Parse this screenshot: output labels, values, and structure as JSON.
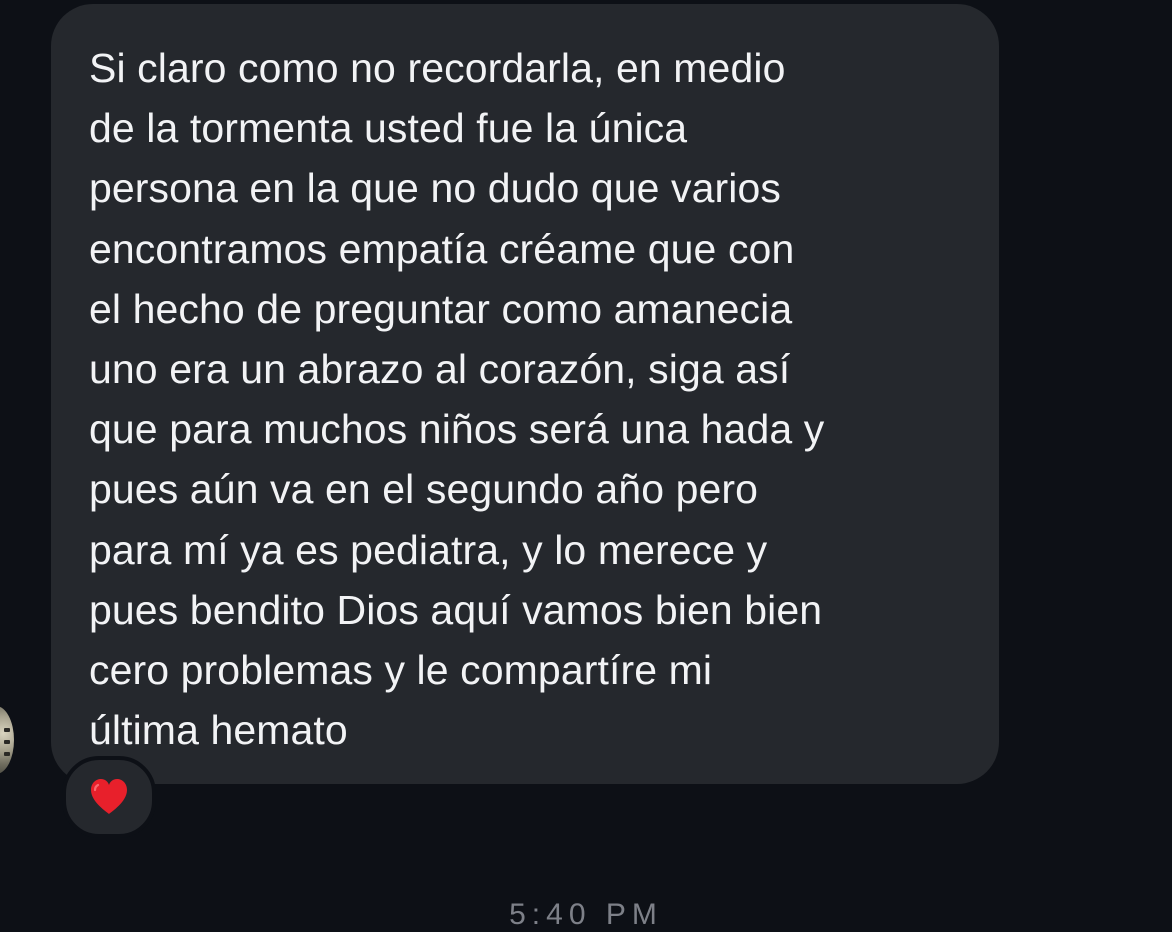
{
  "message": {
    "lines": [
      "Si claro como no recordarla, en medio",
      "de la tormenta usted fue la única",
      "persona en la que no dudo que varios",
      "encontramos empatía créame que con",
      "el hecho de preguntar como amanecia",
      "uno era un abrazo al corazón, siga así",
      "que para muchos niños será una hada y",
      "pues aún va en el segundo año pero",
      "para mí ya es pediatra, y lo merece y",
      "pues bendito Dios aquí vamos bien bien",
      "cero problemas y le compartíre mi",
      "última hemato"
    ],
    "bubble_color": "#25282d",
    "text_color": "#f2f3f5"
  },
  "reaction": {
    "icon": "red-heart-icon",
    "color": "#e8202b"
  },
  "timestamp": "5:40 PM",
  "colors": {
    "background": "#0d1016",
    "timestamp": "#7d8088"
  }
}
